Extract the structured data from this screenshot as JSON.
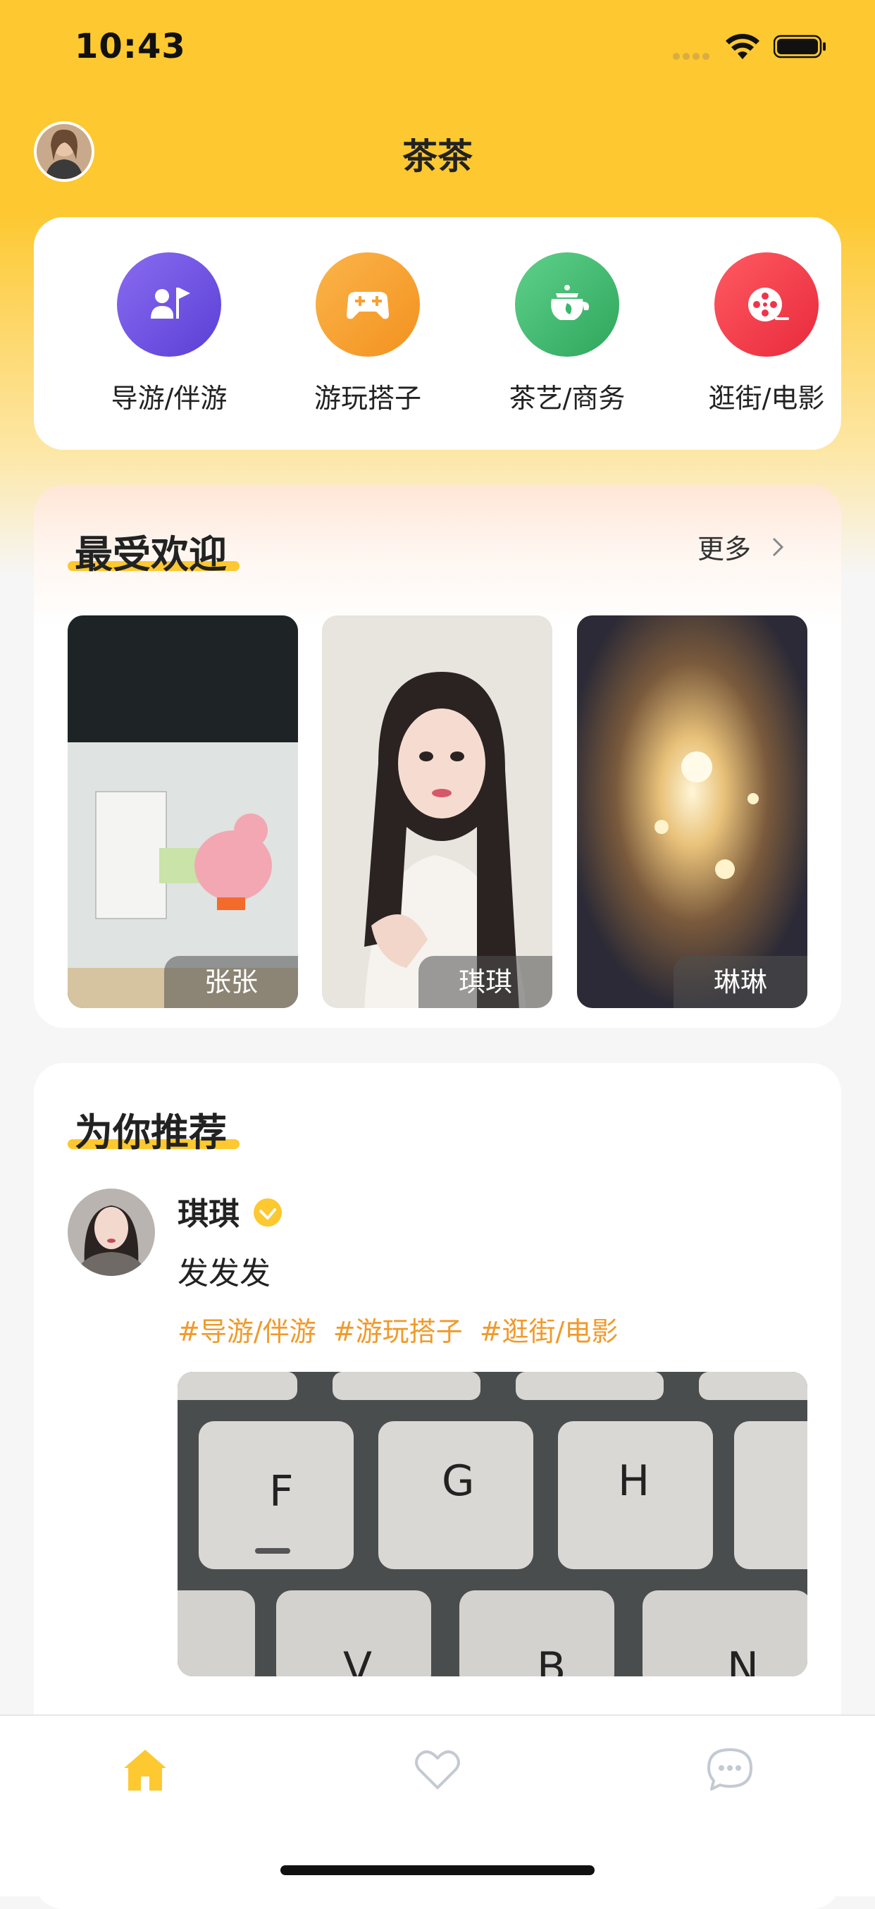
{
  "status_bar": {
    "time": "10:43"
  },
  "header": {
    "title": "茶茶"
  },
  "categories": [
    {
      "label": "导游/伴游",
      "icon": "person-flag-icon",
      "color": "#6a4fe0"
    },
    {
      "label": "游玩搭子",
      "icon": "gamepad-icon",
      "color": "#f7a131"
    },
    {
      "label": "茶艺/商务",
      "icon": "teapot-icon",
      "color": "#37b86a"
    },
    {
      "label": "逛街/电影",
      "icon": "film-reel-icon",
      "color": "#f0344a"
    }
  ],
  "popular": {
    "title": "最受欢迎",
    "more_label": "更多",
    "items": [
      {
        "name": "张张"
      },
      {
        "name": "琪琪"
      },
      {
        "name": "琳琳"
      }
    ]
  },
  "recommend": {
    "title": "为你推荐",
    "post": {
      "user_name": "琪琪",
      "text": "发发发",
      "tags": [
        "#导游/伴游",
        "#游玩搭子",
        "#逛街/电影"
      ]
    }
  },
  "tabbar": {
    "items": [
      {
        "icon": "home-icon",
        "active": true
      },
      {
        "icon": "heart-icon",
        "active": false
      },
      {
        "icon": "chat-bubble-icon",
        "active": false
      }
    ]
  },
  "colors": {
    "brand": "#fdc830",
    "tag": "#f09a2b"
  }
}
